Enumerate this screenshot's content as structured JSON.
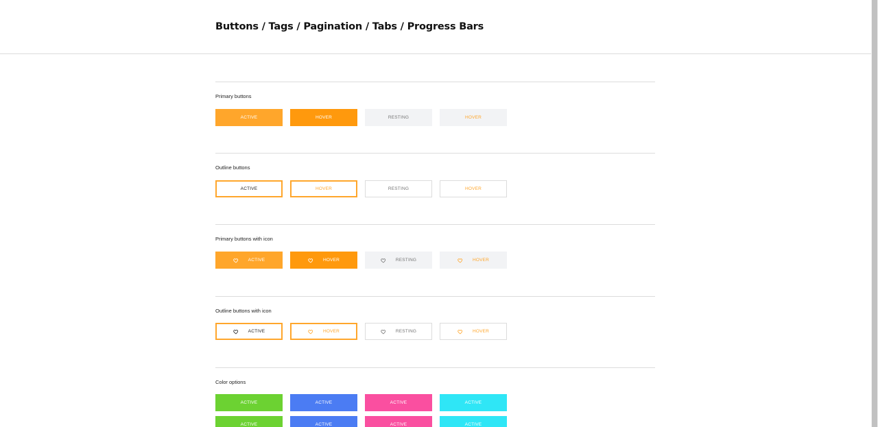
{
  "header": {
    "title": "Buttons / Tags / Pagination / Tabs / Progress Bars"
  },
  "sections": {
    "primary": {
      "title": "Primary buttons",
      "buttons": [
        "ACTIVE",
        "HOVER",
        "RESTING",
        "HOVER"
      ]
    },
    "outline": {
      "title": "Outline buttons",
      "buttons": [
        "ACTIVE",
        "HOVER",
        "RESTING",
        "HOVER"
      ]
    },
    "primary_icon": {
      "title": "Primary buttons with icon",
      "icon": "heart-icon",
      "buttons": [
        "ACTIVE",
        "HOVER",
        "RESTING",
        "HOVER"
      ]
    },
    "outline_icon": {
      "title": "Outline buttons with icon",
      "icon": "heart-icon",
      "buttons": [
        "ACTIVE",
        "HOVER",
        "RESTING",
        "HOVER"
      ]
    },
    "colors": {
      "title": "Color options",
      "row1": [
        "ACTIVE",
        "ACTIVE",
        "ACTIVE",
        "ACTIVE"
      ],
      "row2": [
        "ACTIVE",
        "ACTIVE",
        "ACTIVE",
        "ACTIVE"
      ]
    }
  },
  "colors": {
    "accent": "#ffa62b",
    "accent_hover": "#ff990d",
    "resting_bg": "#f2f3f5",
    "green": "#6cd232",
    "blue": "#4b7cf3",
    "pink": "#fa4fa0",
    "cyan": "#2fe6f6"
  }
}
